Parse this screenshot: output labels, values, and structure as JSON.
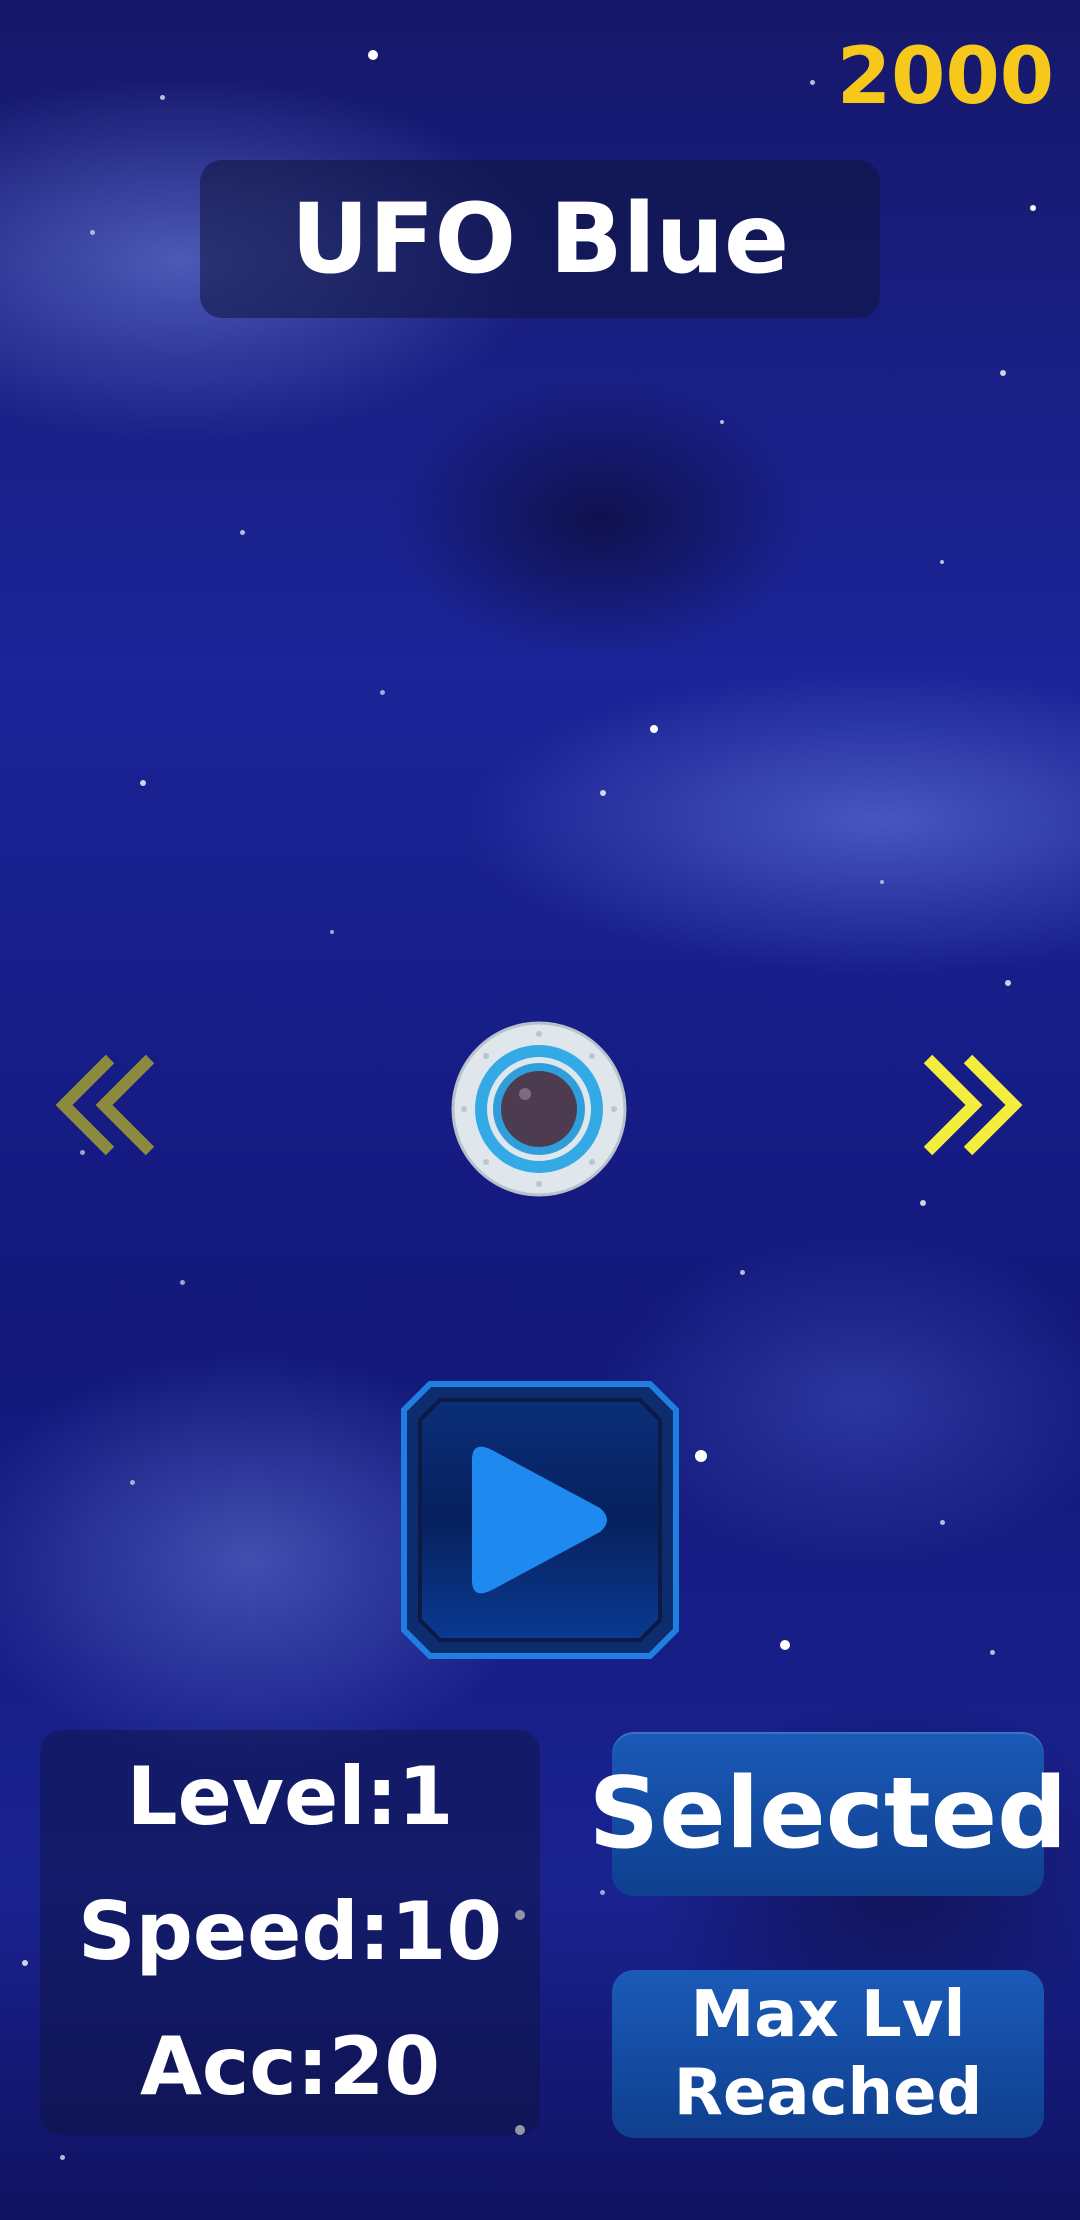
{
  "currency": {
    "amount": "2000",
    "color": "#f6c81c"
  },
  "ship": {
    "name": "UFO Blue",
    "icon": "ufo-blue-icon"
  },
  "nav": {
    "prev_icon": "chevron-double-left-icon",
    "next_icon": "chevron-double-right-icon",
    "prev_color": "#8c8a3c",
    "next_color": "#f3ee3e"
  },
  "play": {
    "icon": "play-icon",
    "accent": "#1e8af0"
  },
  "stats": {
    "level": "Level:1",
    "speed": "Speed:10",
    "acc": "Acc:20"
  },
  "actions": {
    "selected_label": "Selected",
    "max_line1": "Max Lvl",
    "max_line2": "Reached"
  }
}
